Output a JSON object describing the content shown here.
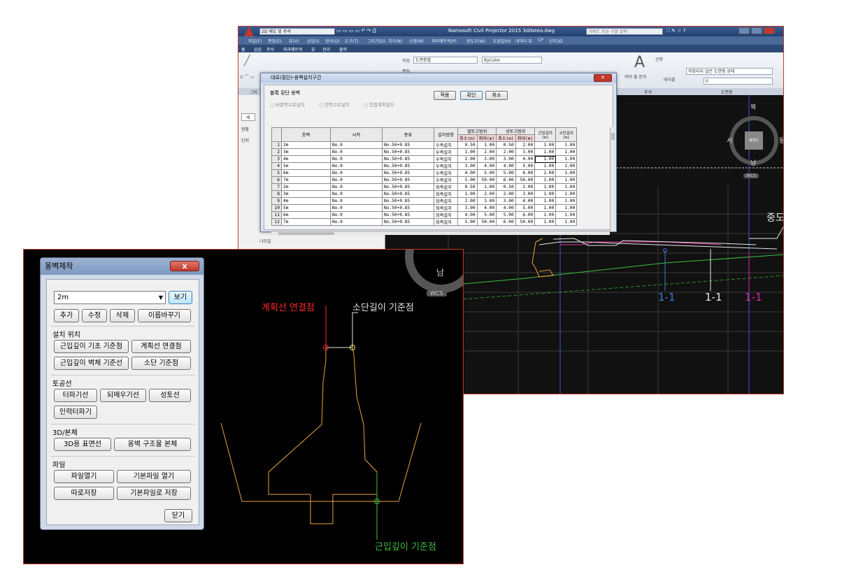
{
  "cad_window": {
    "workspace": "2D 제도 및 주석",
    "title": "Namosoft Civil Projector 2015   3ddatea.dwg",
    "search_placeholder": "키워드 또는 구절 입력",
    "menu": [
      "파일(F)",
      "편집(E)",
      "뷰(V)",
      "삽입(I)",
      "형식(O)",
      "도구(T)",
      "그리기(D)",
      "치수(N)",
      "수정(M)",
      "파라메트릭(P)",
      "윈도우(W)",
      "도움말(H)",
      "데이터 뷰",
      "CP",
      "단지3D"
    ],
    "ribbon_tabs": [
      "홈",
      "삽입",
      "주석",
      "파라메트릭",
      "뷰",
      "관리",
      "출력"
    ],
    "ribbon": {
      "layer_state": "도면층별",
      "color": "ByColor",
      "annot_big": "A",
      "multiline_text": "여러 줄 문자",
      "line_label": "선형",
      "table_label": "테이블",
      "layer_state_label": "저장되지 않은 도면층 상태",
      "layer_value": "0",
      "create": "작성",
      "edit": "편집",
      "panel_left": "그리",
      "panel_annot": "주석",
      "panel_layer": "도면층"
    },
    "left_panel": {
      "new": "새",
      "current": "현황",
      "complex": "단지",
      "tree_item": "나모길"
    },
    "viewcube": {
      "north": "북",
      "south": "남",
      "west": "서",
      "east": "동",
      "top": "평면도",
      "wcs": "WCS"
    },
    "canvas_labels": [
      "1-1",
      "1-1",
      "1-1"
    ],
    "canvas_right_label": "중도"
  },
  "inner_dialog": {
    "title": "대로(횡단)-옹벽설치구간",
    "group_label": "블록 횡단 옹벽",
    "radios": [
      "바깥쪽으로설치",
      "안쪽으로설치",
      "인접계획설치"
    ],
    "buttons": {
      "apply": "적용",
      "ok": "확인",
      "cancel": "취소"
    },
    "columns": [
      "옹벽",
      "시작",
      "종료",
      "설치방향",
      "절토고범위",
      "성토고범위",
      "근입깊이 (m)",
      "소단길이 (m)"
    ],
    "subcolumns": [
      "최소(m)",
      "최대(m)",
      "최소(m)",
      "최대(m)"
    ],
    "rows": [
      [
        "1",
        "2m",
        "No.0",
        "No.50+0.85",
        "우측설치",
        "0.50",
        "1.00",
        "0.50",
        "2.00",
        "1.00",
        "1.00"
      ],
      [
        "2",
        "3m",
        "No.0",
        "No.50+0.85",
        "우측설치",
        "1.00",
        "2.00",
        "2.00",
        "3.00",
        "1.00",
        "1.00"
      ],
      [
        "3",
        "4m",
        "No.0",
        "No.50+0.85",
        "우측설치",
        "2.00",
        "3.00",
        "3.00",
        "4.00",
        "1.00",
        "1.00"
      ],
      [
        "4",
        "5m",
        "No.0",
        "No.50+0.85",
        "우측설치",
        "3.00",
        "4.00",
        "4.00",
        "5.00",
        "1.00",
        "1.00"
      ],
      [
        "5",
        "6m",
        "No.0",
        "No.50+0.85",
        "우측설치",
        "4.00",
        "5.00",
        "5.00",
        "6.00",
        "1.00",
        "1.00"
      ],
      [
        "6",
        "7m",
        "No.0",
        "No.50+0.85",
        "우측설치",
        "5.00",
        "50.00",
        "6.00",
        "50.00",
        "1.00",
        "1.00"
      ],
      [
        "7",
        "2m",
        "No.0",
        "No.50+0.85",
        "좌측설치",
        "0.50",
        "1.00",
        "0.50",
        "2.00",
        "1.00",
        "1.00"
      ],
      [
        "8",
        "3m",
        "No.0",
        "No.50+0.85",
        "좌측설치",
        "1.00",
        "2.00",
        "2.00",
        "3.00",
        "1.00",
        "1.00"
      ],
      [
        "9",
        "4m",
        "No.0",
        "No.50+0.85",
        "좌측설치",
        "2.00",
        "3.00",
        "3.00",
        "4.00",
        "1.00",
        "1.00"
      ],
      [
        "10",
        "5m",
        "No.0",
        "No.50+0.85",
        "좌측설치",
        "3.00",
        "4.00",
        "4.00",
        "5.00",
        "1.00",
        "1.00"
      ],
      [
        "11",
        "6m",
        "No.0",
        "No.50+0.85",
        "좌측설치",
        "4.00",
        "5.00",
        "5.00",
        "6.00",
        "1.00",
        "1.00"
      ],
      [
        "12",
        "7m",
        "No.0",
        "No.50+0.85",
        "좌측설치",
        "5.00",
        "50.00",
        "6.00",
        "50.00",
        "1.00",
        "1.00"
      ]
    ]
  },
  "palette": {
    "title": "옹벽제작",
    "close_label": "x",
    "selected": "2m",
    "view_button": "보기",
    "edit_buttons": [
      "추가",
      "수정",
      "삭제",
      "이름바꾸기"
    ],
    "install_position_label": "설치 위치",
    "install_buttons": [
      "근입깊이 기초 기준점",
      "계획선 연결점",
      "근입깊이 벽체 기준선",
      "소단 기준점"
    ],
    "earthwork_label": "토공선",
    "earthwork_buttons": [
      "터파기선",
      "되메우기선",
      "성토선",
      "인력터파기"
    ],
    "body_label": "3D/본체",
    "body_buttons": [
      "3D용 표면선",
      "옹벽 구조물 본체"
    ],
    "file_label": "파일",
    "file_buttons": [
      "파일열기",
      "기본파일 열기",
      "따로저장",
      "기본파일로 저장"
    ],
    "close_button": "닫기"
  },
  "drawing_labels": {
    "plan_connect": "계획선 연결점",
    "berm_base": "소단길이 기준점",
    "embed_base": "근입깊이 기준점",
    "south": "남",
    "wcs": "WCS"
  },
  "colors": {
    "red": "#ff2a2a",
    "white": "#e6e6e6",
    "green": "#3fbf3f",
    "orange": "#e8a33c",
    "accent": "#c0392b"
  }
}
